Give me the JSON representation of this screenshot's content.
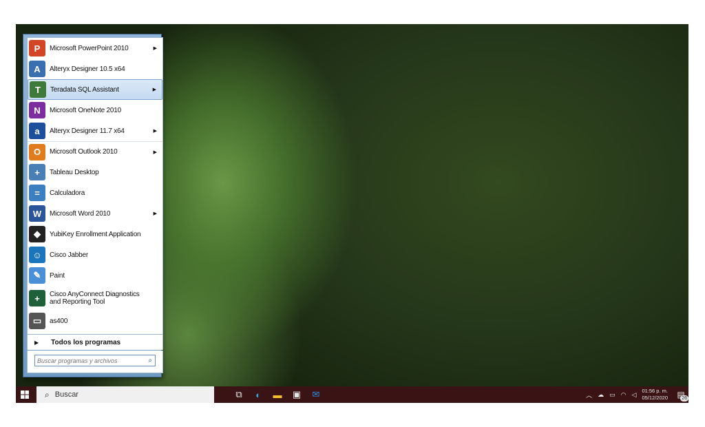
{
  "start_menu": {
    "programs": [
      {
        "label": "Microsoft PowerPoint 2010",
        "has_submenu": true,
        "icon": "powerpoint-icon",
        "color": "#d24625",
        "glyph": "P"
      },
      {
        "label": "Alteryx Designer 10.5 x64",
        "has_submenu": false,
        "icon": "alteryx-icon",
        "color": "#3a6fb0",
        "glyph": "A"
      },
      {
        "label": "Teradata SQL Assistant",
        "has_submenu": true,
        "icon": "teradata-icon",
        "color": "#3f7a3a",
        "glyph": "T",
        "highlighted": true
      },
      {
        "label": "Microsoft OneNote 2010",
        "has_submenu": false,
        "icon": "onenote-icon",
        "color": "#7b2f9e",
        "glyph": "N"
      },
      {
        "label": "Alteryx Designer 11.7 x64",
        "has_submenu": true,
        "icon": "alteryx-a-icon",
        "color": "#1d4f9c",
        "glyph": "a"
      },
      {
        "label": "Microsoft Outlook 2010",
        "has_submenu": true,
        "icon": "outlook-icon",
        "color": "#e07b1e",
        "glyph": "O"
      },
      {
        "label": "Tableau Desktop",
        "has_submenu": false,
        "icon": "tableau-icon",
        "color": "#4a7fb5",
        "glyph": "+"
      },
      {
        "label": "Calculadora",
        "has_submenu": false,
        "icon": "calculator-icon",
        "color": "#3c7fc1",
        "glyph": "="
      },
      {
        "label": "Microsoft Word 2010",
        "has_submenu": true,
        "icon": "word-icon",
        "color": "#2a5699",
        "glyph": "W"
      },
      {
        "label": "YubiKey Enrollment Application",
        "has_submenu": false,
        "icon": "yubikey-icon",
        "color": "#222222",
        "glyph": "◆"
      },
      {
        "label": "Cisco Jabber",
        "has_submenu": false,
        "icon": "jabber-icon",
        "color": "#1b75bc",
        "glyph": "☺"
      },
      {
        "label": "Paint",
        "has_submenu": false,
        "icon": "paint-icon",
        "color": "#4a90d9",
        "glyph": "✎"
      },
      {
        "label": "Cisco AnyConnect Diagnostics\nand Reporting Tool",
        "has_submenu": false,
        "icon": "anyconnect-icon",
        "color": "#1f5f3a",
        "glyph": "+",
        "two_line": true
      },
      {
        "label": "as400",
        "has_submenu": false,
        "icon": "as400-icon",
        "color": "#555555",
        "glyph": "▭"
      }
    ],
    "all_programs_label": "Todos los programas",
    "search_placeholder": "Buscar programas y archivos"
  },
  "taskbar": {
    "search_placeholder": "Buscar",
    "pinned": [
      {
        "icon": "task-view-icon",
        "glyph": "⧉",
        "color": "#e8e8e8"
      },
      {
        "icon": "edge-icon",
        "glyph": "◐",
        "color": "#2fa3e6"
      },
      {
        "icon": "file-explorer-icon",
        "glyph": "▬",
        "color": "#f2c12e"
      },
      {
        "icon": "store-icon",
        "glyph": "▣",
        "color": "#e8e8e8"
      },
      {
        "icon": "mail-icon",
        "glyph": "✉",
        "color": "#2f8fe0"
      }
    ],
    "time": "01:56 p. m.",
    "date": "05/12/2020",
    "notification_count": "26"
  }
}
